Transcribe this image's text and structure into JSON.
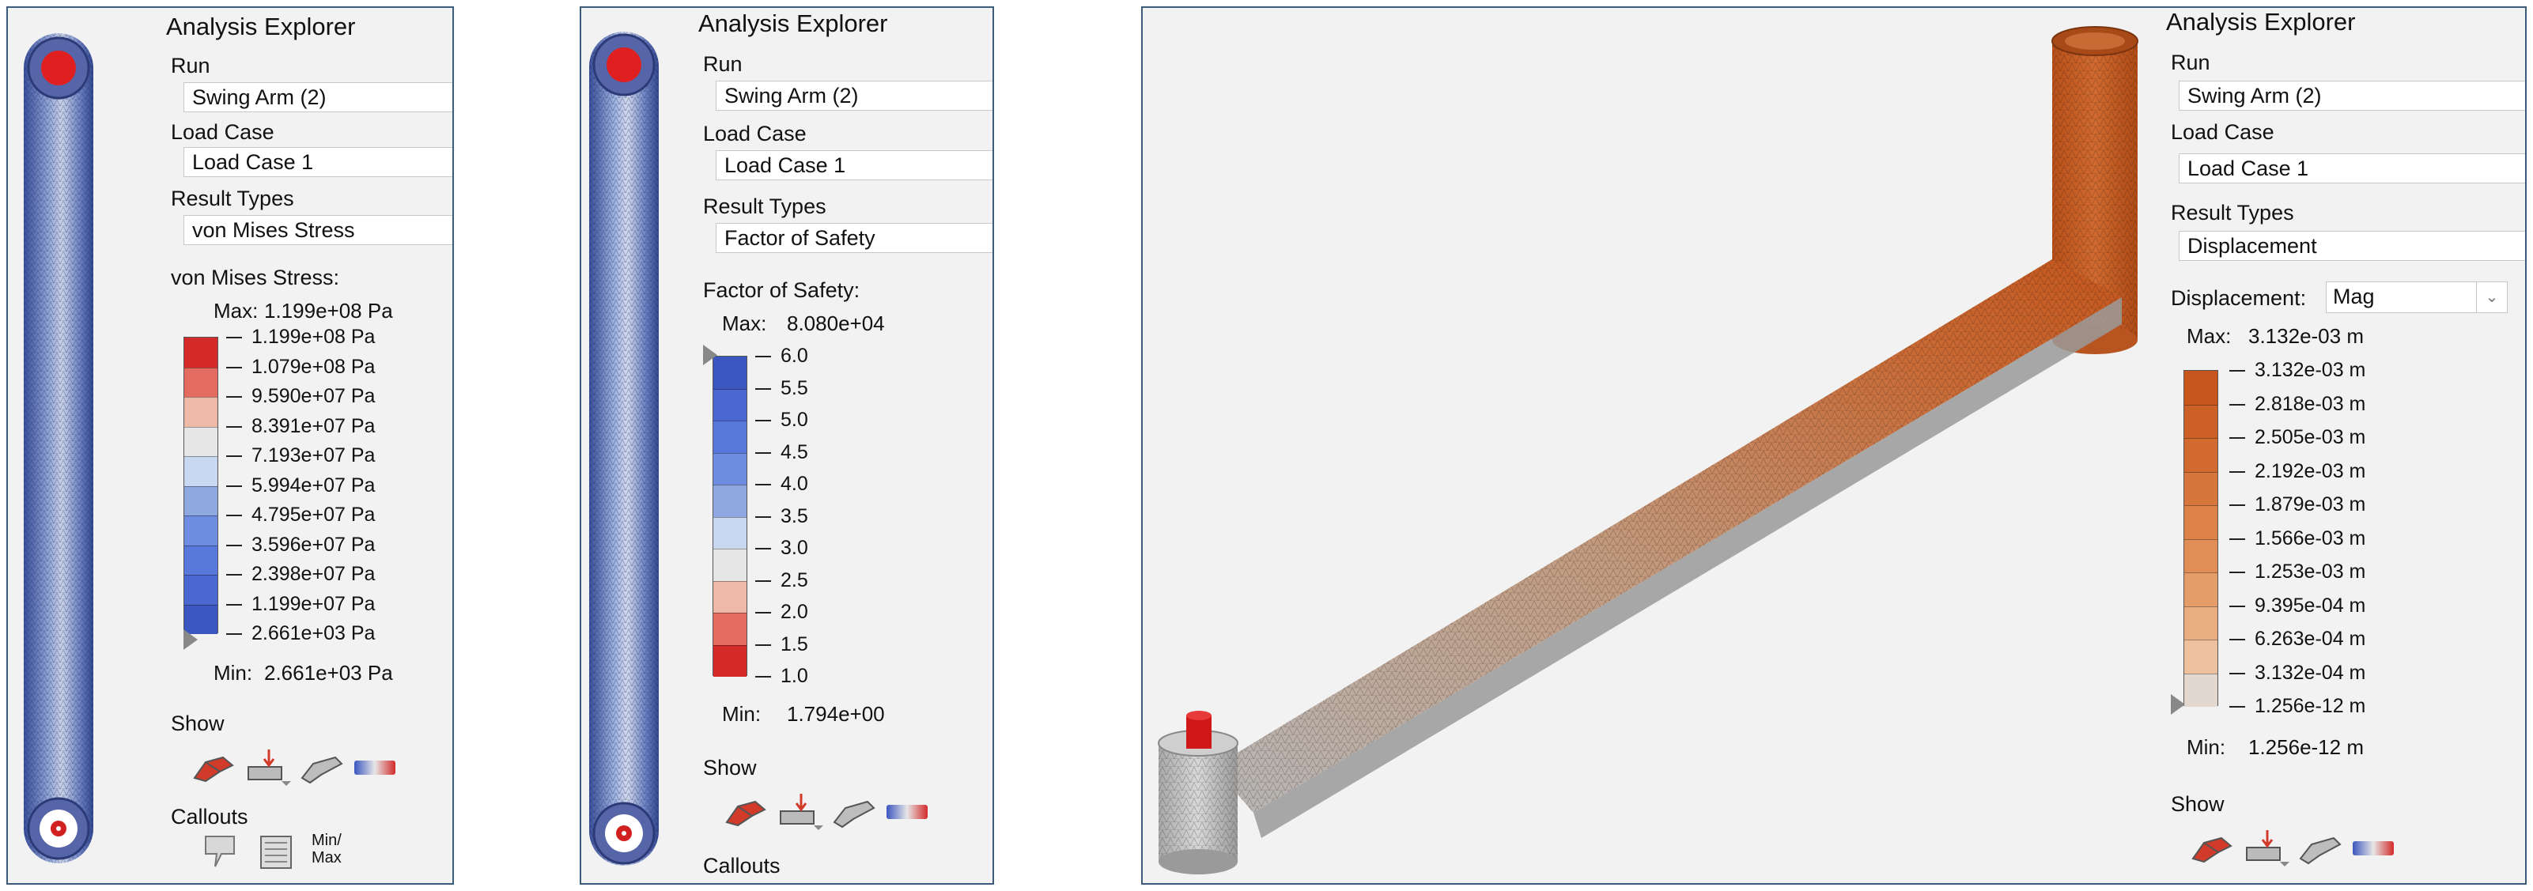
{
  "panels": [
    {
      "explorer_title": "Analysis Explorer",
      "run_label": "Run",
      "run_value": "Swing Arm (2)",
      "loadcase_label": "Load Case",
      "loadcase_value": "Load Case 1",
      "resulttypes_label": "Result Types",
      "resulttypes_value": "von Mises Stress",
      "legend_title": "von Mises Stress:",
      "max_label": "Max:",
      "max_value": "1.199e+08 Pa",
      "min_label": "Min:",
      "min_value": "2.661e+03 Pa",
      "ticks": [
        "1.199e+08 Pa",
        "1.079e+08 Pa",
        "9.590e+07 Pa",
        "8.391e+07 Pa",
        "7.193e+07 Pa",
        "5.994e+07 Pa",
        "4.795e+07 Pa",
        "3.596e+07 Pa",
        "2.398e+07 Pa",
        "1.199e+07 Pa",
        "2.661e+03 Pa"
      ],
      "colors": [
        "#d42a2a",
        "#e36b60",
        "#efb9a8",
        "#e6e6e6",
        "#c8d8f0",
        "#8fa8e0",
        "#6f8de0",
        "#5878dc",
        "#4a68d0",
        "#3c56c0"
      ],
      "show_label": "Show",
      "callouts_label": "Callouts",
      "minmax_label": "Min/\nMax",
      "icons": [
        "deformed-shape-icon",
        "load-arrow-icon",
        "undeformed-shape-icon",
        "legend-bar-icon"
      ]
    },
    {
      "explorer_title": "Analysis Explorer",
      "run_label": "Run",
      "run_value": "Swing Arm (2)",
      "loadcase_label": "Load Case",
      "loadcase_value": "Load Case 1",
      "resulttypes_label": "Result Types",
      "resulttypes_value": "Factor of Safety",
      "legend_title": "Factor of Safety:",
      "max_label": "Max:",
      "max_value": "8.080e+04",
      "min_label": "Min:",
      "min_value": "1.794e+00",
      "ticks": [
        "6.0",
        "5.5",
        "5.0",
        "4.5",
        "4.0",
        "3.5",
        "3.0",
        "2.5",
        "2.0",
        "1.5",
        "1.0"
      ],
      "colors": [
        "#3c56c0",
        "#4a68d0",
        "#5878dc",
        "#6f8de0",
        "#8fa8e0",
        "#c8d8f0",
        "#e6e6e6",
        "#efb9a8",
        "#e36b60",
        "#d42a2a"
      ],
      "show_label": "Show",
      "callouts_label": "Callouts"
    },
    {
      "explorer_title": "Analysis Explorer",
      "run_label": "Run",
      "run_value": "Swing Arm (2)",
      "loadcase_label": "Load Case",
      "loadcase_value": "Load Case 1",
      "resulttypes_label": "Result Types",
      "resulttypes_value": "Displacement",
      "legend_title": "Displacement:",
      "component_value": "Mag",
      "max_label": "Max:",
      "max_value": "3.132e-03 m",
      "min_label": "Min:",
      "min_value": "1.256e-12 m",
      "ticks": [
        "3.132e-03 m",
        "2.818e-03 m",
        "2.505e-03 m",
        "2.192e-03 m",
        "1.879e-03 m",
        "1.566e-03 m",
        "1.253e-03 m",
        "9.395e-04 m",
        "6.263e-04 m",
        "3.132e-04 m",
        "1.256e-12 m"
      ],
      "colors": [
        "#c8561c",
        "#cd6026",
        "#d26a30",
        "#d7763c",
        "#dc8248",
        "#e08e56",
        "#e49c68",
        "#e9ad80",
        "#eec19e",
        "#e3d8cf"
      ],
      "show_label": "Show"
    }
  ]
}
